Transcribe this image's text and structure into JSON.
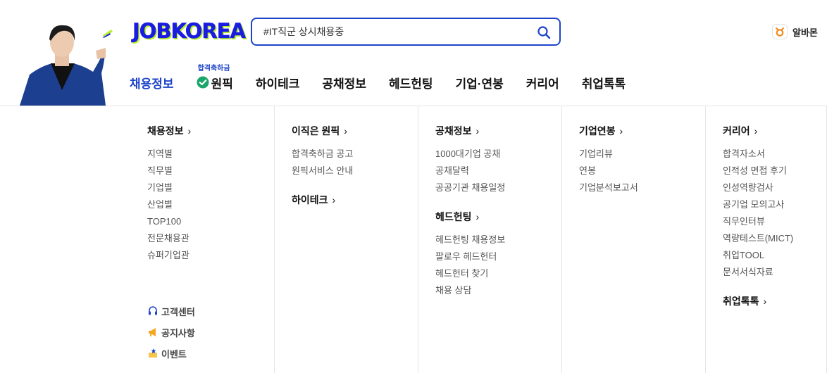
{
  "header": {
    "logo": "JOBKOREA",
    "search": {
      "placeholder": "#IT직군 상시채용중",
      "icon": "search-icon"
    },
    "albamon": {
      "label": "알바몬",
      "accent": "#f08a1c"
    },
    "brand_color": "#1d44c8",
    "nav": [
      {
        "label": "채용정보",
        "active": true
      },
      {
        "label": "원픽",
        "badge": "합격축하금",
        "icon": "check-circle-icon"
      },
      {
        "label": "하이테크"
      },
      {
        "label": "공채정보"
      },
      {
        "label": "헤드헌팅"
      },
      {
        "label": "기업·연봉"
      },
      {
        "label": "커리어"
      },
      {
        "label": "취업톡톡"
      }
    ]
  },
  "menu": {
    "col1": {
      "title": "채용정보",
      "links": [
        "지역별",
        "직무별",
        "기업별",
        "산업별",
        "TOP100",
        "전문채용관",
        "슈퍼기업관"
      ],
      "util": [
        "고객센터",
        "공지사항",
        "이벤트"
      ]
    },
    "col2": {
      "title": "이직은 원픽",
      "links": [
        "합격축하금 공고",
        "원픽서비스 안내"
      ],
      "title2": "하이테크"
    },
    "col3": {
      "title": "공채정보",
      "links": [
        "1000대기업 공채",
        "공채달력",
        "공공기관 채용일정"
      ],
      "title2": "헤드헌팅",
      "links2": [
        "헤드헌팅 채용정보",
        "팔로우 헤드헌터",
        "헤드헌터 찾기",
        "채용 상담"
      ]
    },
    "col4": {
      "title": "기업연봉",
      "links": [
        "기업리뷰",
        "연봉",
        "기업분석보고서"
      ]
    },
    "col5": {
      "title": "커리어",
      "links": [
        "합격자소서",
        "인적성 면접 후기",
        "인성역량검사",
        "공기업 모의고사",
        "직무인터뷰",
        "역량테스트(MICT)",
        "취업TOOL",
        "문서서식자료"
      ],
      "title2": "취업톡톡"
    }
  }
}
